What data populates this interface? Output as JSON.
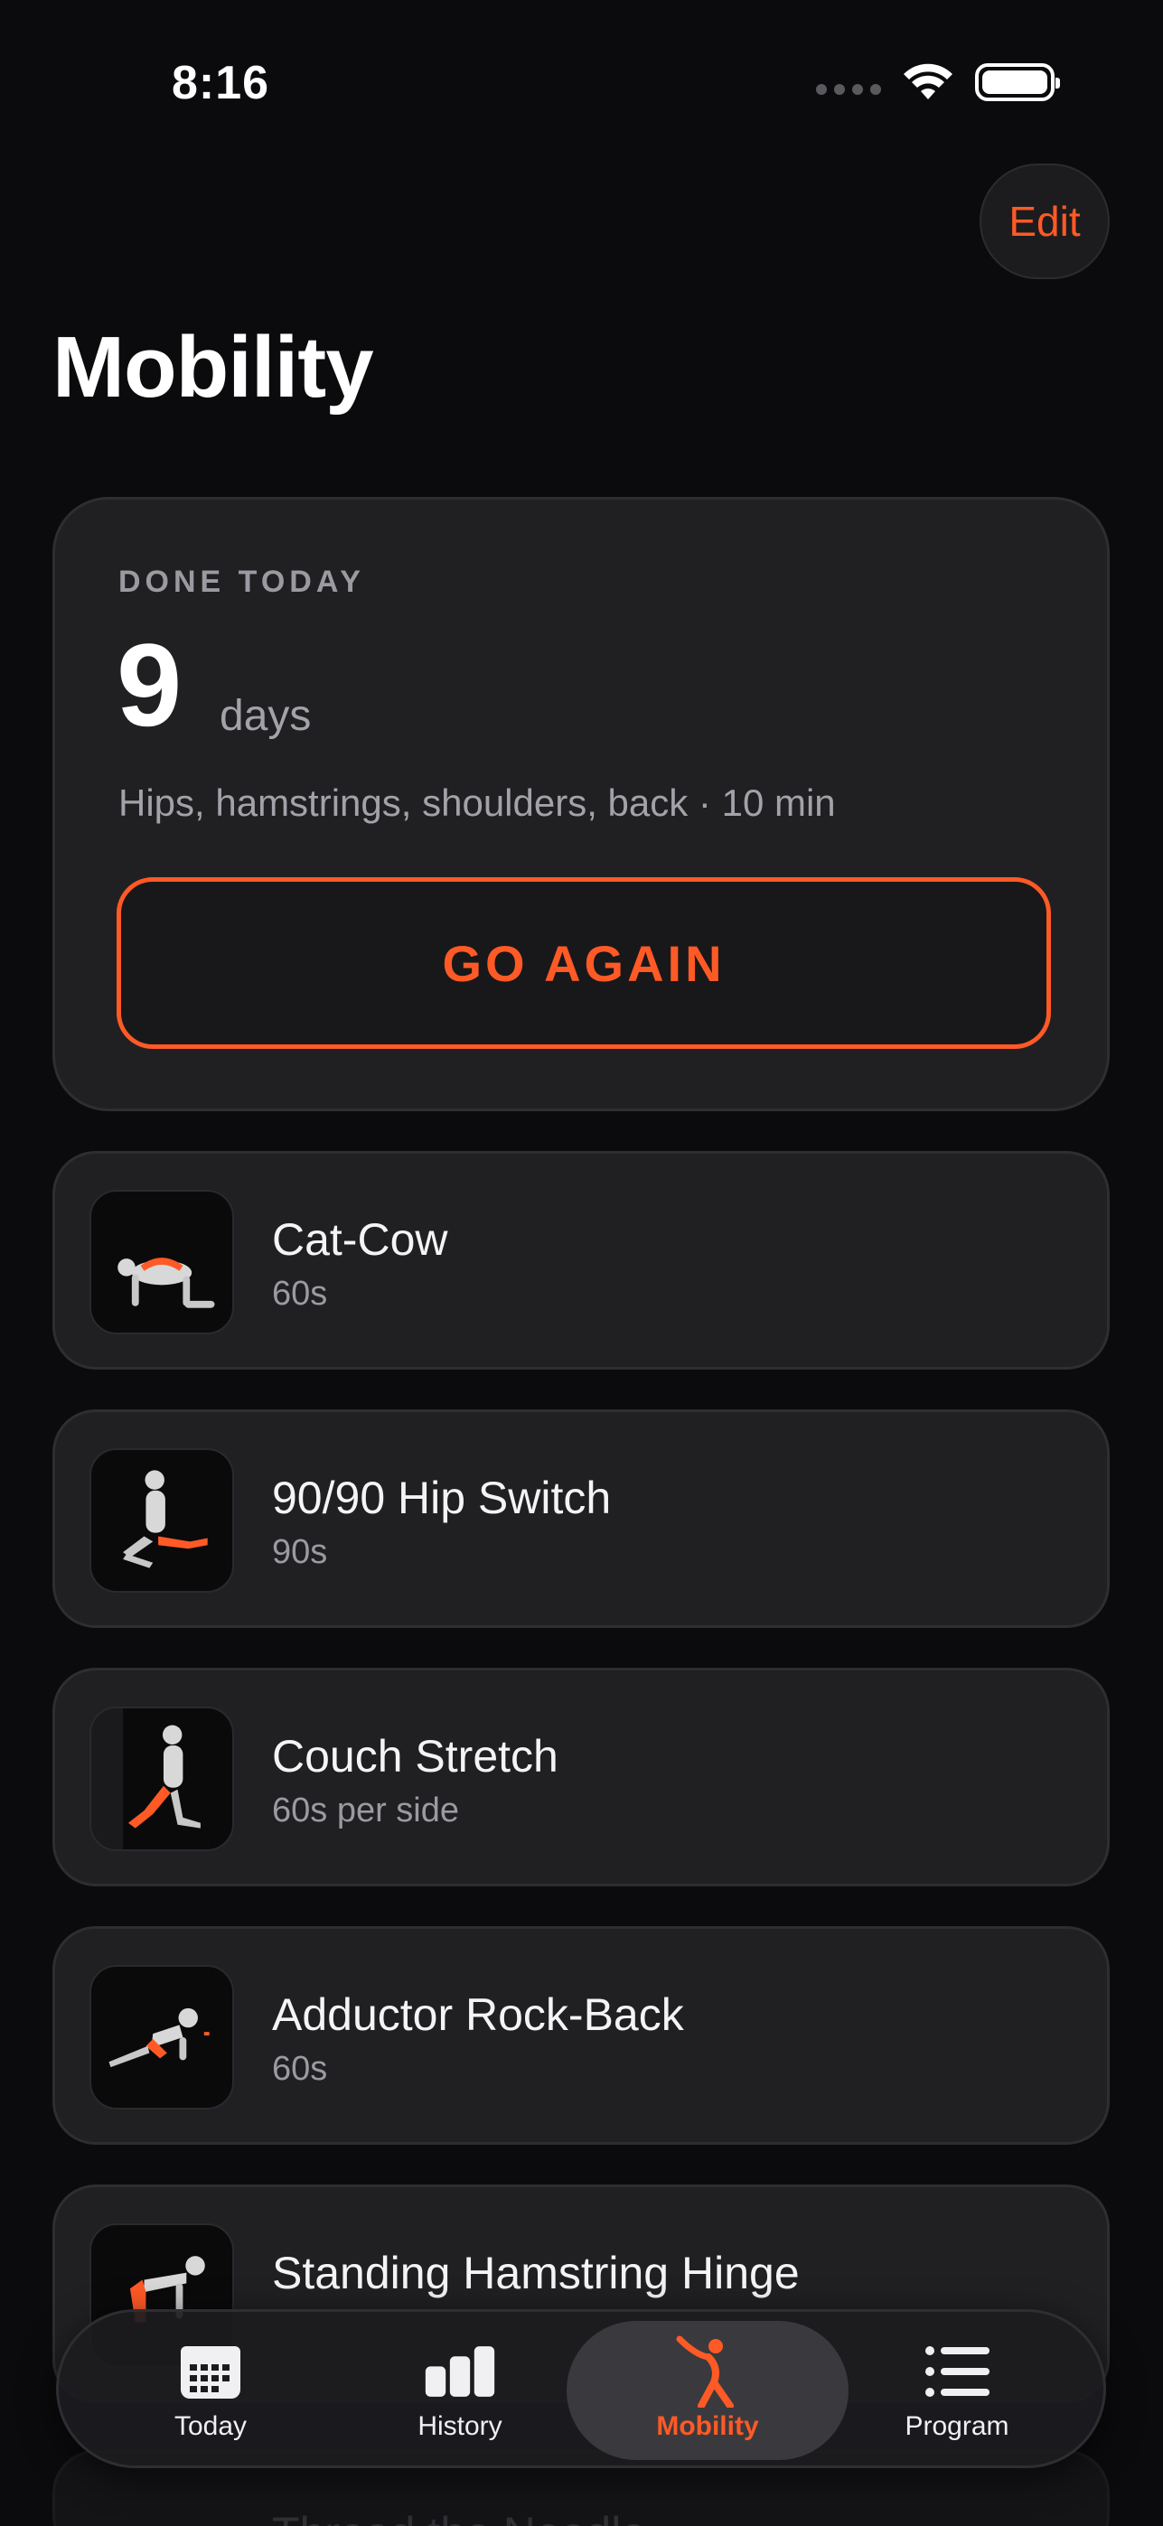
{
  "status_bar": {
    "time": "8:16"
  },
  "header": {
    "edit_label": "Edit",
    "title": "Mobility"
  },
  "summary": {
    "label": "DONE TODAY",
    "count": "9",
    "unit": "days",
    "description": "Hips, hamstrings, shoulders, back · 10 min",
    "button_label": "GO AGAIN"
  },
  "exercises": [
    {
      "name": "Cat-Cow",
      "duration": "60s"
    },
    {
      "name": "90/90 Hip Switch",
      "duration": "90s"
    },
    {
      "name": "Couch Stretch",
      "duration": "60s per side"
    },
    {
      "name": "Adductor Rock-Back",
      "duration": "60s"
    },
    {
      "name": "Standing Hamstring Hinge",
      "duration": ""
    },
    {
      "name": "Thread the Needle",
      "duration": ""
    }
  ],
  "tab_bar": {
    "active": "Mobility",
    "tabs": [
      {
        "label": "Today",
        "icon": "calendar-icon"
      },
      {
        "label": "History",
        "icon": "bar-chart-icon"
      },
      {
        "label": "Mobility",
        "icon": "stretch-figure-icon"
      },
      {
        "label": "Program",
        "icon": "list-icon"
      }
    ]
  },
  "colors": {
    "accent": "#ff5a26",
    "background": "#0b0b0d",
    "card": "#202023"
  }
}
